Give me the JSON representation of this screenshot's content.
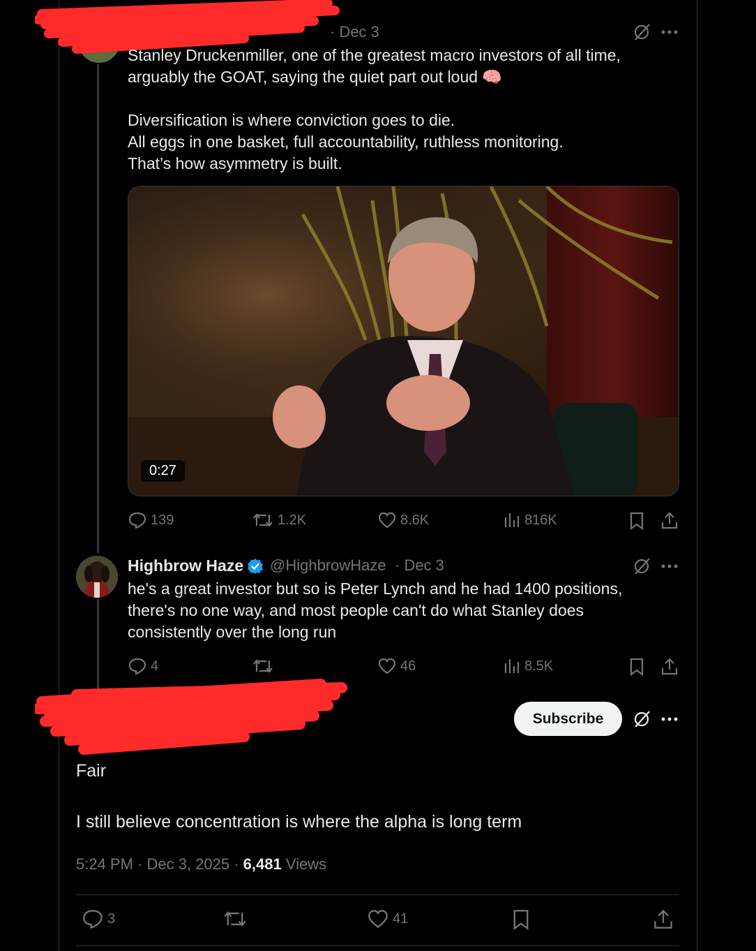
{
  "tweet1": {
    "date": "· Dec 3",
    "text": "Stanley Druckenmiller, one of the greatest macro investors of all time,\narguably the GOAT, saying the quiet part out loud 🧠\n\nDiversification is where conviction goes to die.\nAll eggs in one basket, full accountability, ruthless monitoring.\nThat’s how asymmetry is built.",
    "video_duration": "0:27",
    "stats": {
      "replies": "139",
      "reposts": "1.2K",
      "likes": "8.6K",
      "views": "816K"
    }
  },
  "tweet2": {
    "name": "Highbrow Haze",
    "handle": "@HighbrowHaze",
    "date": "· Dec 3",
    "text": "he's a great investor but so is Peter Lynch and he had 1400 positions,\nthere's no one way, and most people can't do what Stanley does\nconsistently over the long run",
    "stats": {
      "replies": "4",
      "reposts": "",
      "likes": "46",
      "views": "8.5K"
    }
  },
  "main_tweet": {
    "subscribe_label": "Subscribe",
    "line1": "Fair",
    "line2": "I still believe concentration is where the alpha is long term",
    "timestamp": "5:24 PM · Dec 3, 2025 · ",
    "views_count": "6,481",
    "views_label": " Views",
    "stats": {
      "replies": "3",
      "likes": "41"
    }
  },
  "colors": {
    "accent_verified": "#1d9bf0",
    "redaction": "#ff2b2b",
    "muted": "#71767b"
  }
}
